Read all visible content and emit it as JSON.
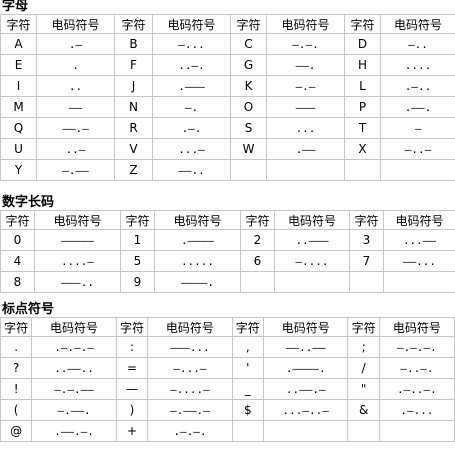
{
  "sections": {
    "letters": {
      "title": "字母",
      "headers": [
        "字符",
        "电码符号",
        "字符",
        "电码符号",
        "字符",
        "电码符号",
        "字符",
        "电码符号"
      ],
      "rows": [
        [
          "A",
          ".—",
          "B",
          "—...",
          "C",
          "—.—.",
          "D",
          "—.."
        ],
        [
          "E",
          ".",
          "F",
          "..—.",
          "G",
          "——.",
          "H",
          "...."
        ],
        [
          "I",
          "..",
          "J",
          ".———",
          "K",
          "—.—",
          "L",
          ".—.."
        ],
        [
          "M",
          "——",
          "N",
          "—.",
          "O",
          "———",
          "P",
          ".——."
        ],
        [
          "Q",
          "——.—",
          "R",
          ".—.",
          "S",
          "...",
          "T",
          "—"
        ],
        [
          "U",
          "..—",
          "V",
          "...—",
          "W",
          ".——",
          "X",
          "—..—"
        ],
        [
          "Y",
          "—.——",
          "Z",
          "——..",
          "",
          "",
          "",
          ""
        ]
      ]
    },
    "digits": {
      "title": "数字长码",
      "headers": [
        "字符",
        "电码符号",
        "字符",
        "电码符号",
        "字符",
        "电码符号",
        "字符",
        "电码符号"
      ],
      "rows": [
        [
          "0",
          "—————",
          "1",
          ".————",
          "2",
          "..———",
          "3",
          "...——"
        ],
        [
          "4",
          "....—",
          "5",
          ".....",
          "6",
          "—....",
          "7",
          "——..."
        ],
        [
          "8",
          "———..",
          "9",
          "————.",
          "",
          "",
          "",
          ""
        ]
      ]
    },
    "punct": {
      "title": "标点符号",
      "headers": [
        "字符",
        "电码符号",
        "字符",
        "电码符号",
        "字符",
        "电码符号",
        "字符",
        "电码符号"
      ],
      "rows": [
        [
          ".",
          ".—.—.—",
          ":",
          "———...",
          ",",
          "——..——",
          ";",
          "—.—.—."
        ],
        [
          "?",
          "..——..",
          "=",
          "—...—",
          "'",
          ".————.",
          "/",
          "—..—."
        ],
        [
          "!",
          "—.—.——",
          "—",
          "—....—",
          "_",
          "..——.—",
          "\"",
          ".—..—."
        ],
        [
          "(",
          "—.——.",
          ")",
          "—.——.—",
          "$",
          "...—..—",
          "&",
          ".—..."
        ],
        [
          "@",
          ".——.—.",
          "+",
          ".—.—.",
          "",
          "",
          "",
          ""
        ]
      ]
    }
  }
}
